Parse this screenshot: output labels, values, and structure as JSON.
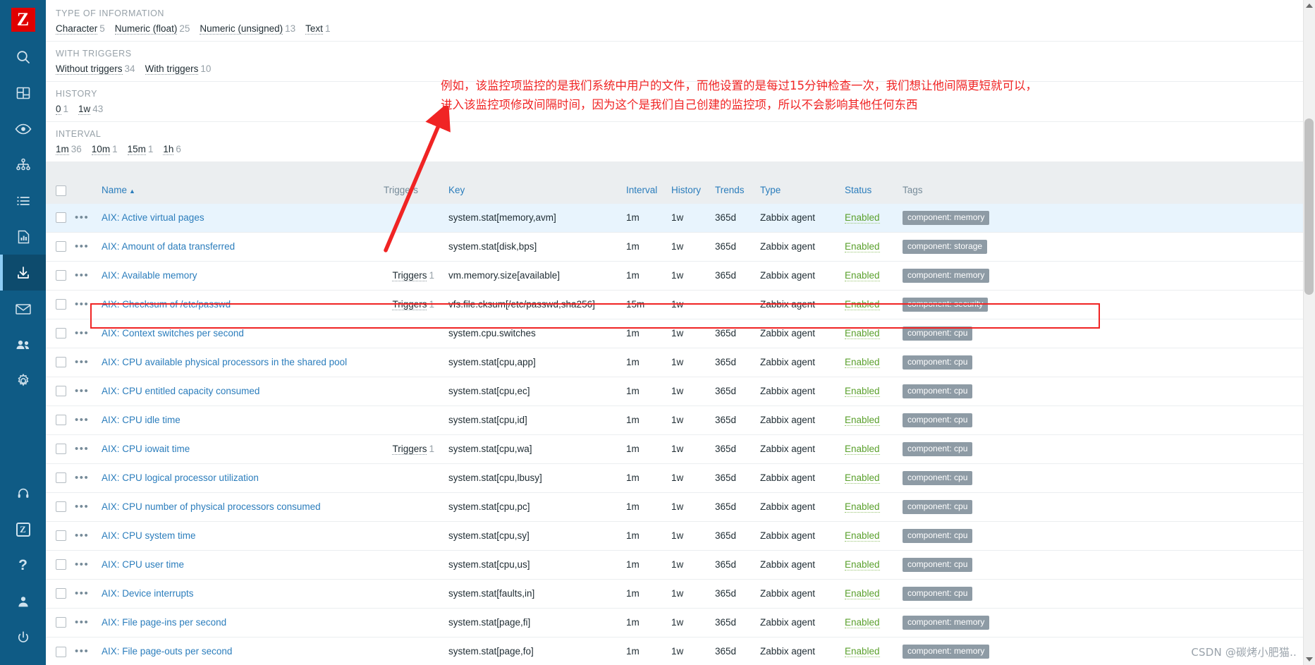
{
  "sidebar": {
    "logo_text": "Z",
    "items": [
      {
        "name": "search-icon",
        "label": "Search"
      },
      {
        "name": "dashboard-icon",
        "label": "Dashboards"
      },
      {
        "name": "eye-icon",
        "label": "Monitoring"
      },
      {
        "name": "network-map-icon",
        "label": "Services"
      },
      {
        "name": "list-icon",
        "label": "Inventory"
      },
      {
        "name": "report-icon",
        "label": "Reports"
      },
      {
        "name": "download-icon",
        "label": "Data collection",
        "active": true
      },
      {
        "name": "envelope-icon",
        "label": "Alerts"
      },
      {
        "name": "users-icon",
        "label": "Users"
      },
      {
        "name": "gear-icon",
        "label": "Administration"
      }
    ],
    "bottom_items": [
      {
        "name": "support-icon",
        "label": "Support"
      },
      {
        "name": "zabbix-integration-icon",
        "label": "Integrations"
      },
      {
        "name": "help-icon",
        "label": "Help"
      },
      {
        "name": "user-profile-icon",
        "label": "User settings"
      },
      {
        "name": "power-icon",
        "label": "Sign out"
      }
    ]
  },
  "filters": [
    {
      "title": "TYPE OF INFORMATION",
      "items": [
        {
          "label": "Character",
          "count": "5"
        },
        {
          "label": "Numeric (float)",
          "count": "25"
        },
        {
          "label": "Numeric (unsigned)",
          "count": "13"
        },
        {
          "label": "Text",
          "count": "1"
        }
      ]
    },
    {
      "title": "WITH TRIGGERS",
      "items": [
        {
          "label": "Without triggers",
          "count": "34"
        },
        {
          "label": "With triggers",
          "count": "10"
        }
      ]
    },
    {
      "title": "HISTORY",
      "items": [
        {
          "label": "0",
          "count": "1"
        },
        {
          "label": "1w",
          "count": "43"
        }
      ]
    },
    {
      "title": "INTERVAL",
      "items": [
        {
          "label": "1m",
          "count": "36"
        },
        {
          "label": "10m",
          "count": "1"
        },
        {
          "label": "15m",
          "count": "1"
        },
        {
          "label": "1h",
          "count": "6"
        }
      ]
    }
  ],
  "table": {
    "headers": {
      "name": "Name",
      "sort_arrow": "▲",
      "triggers": "Triggers",
      "key": "Key",
      "interval": "Interval",
      "history": "History",
      "trends": "Trends",
      "type": "Type",
      "status": "Status",
      "tags": "Tags"
    },
    "dots_glyph": "•••",
    "rows": [
      {
        "name": "AIX: Active virtual pages",
        "triggers": "",
        "triggers_count": "",
        "key": "system.stat[memory,avm]",
        "interval": "1m",
        "history": "1w",
        "trends": "365d",
        "type": "Zabbix agent",
        "status": "Enabled",
        "tag": "component: memory",
        "highlight": true
      },
      {
        "name": "AIX: Amount of data transferred",
        "triggers": "",
        "triggers_count": "",
        "key": "system.stat[disk,bps]",
        "interval": "1m",
        "history": "1w",
        "trends": "365d",
        "type": "Zabbix agent",
        "status": "Enabled",
        "tag": "component: storage"
      },
      {
        "name": "AIX: Available memory",
        "triggers": "Triggers",
        "triggers_count": "1",
        "key": "vm.memory.size[available]",
        "interval": "1m",
        "history": "1w",
        "trends": "365d",
        "type": "Zabbix agent",
        "status": "Enabled",
        "tag": "component: memory"
      },
      {
        "name": "AIX: Checksum of /etc/passwd",
        "triggers": "Triggers",
        "triggers_count": "1",
        "key": "vfs.file.cksum[/etc/passwd,sha256]",
        "interval": "15m",
        "history": "1w",
        "trends": "",
        "type": "Zabbix agent",
        "status": "Enabled",
        "tag": "component: security",
        "boxed": true
      },
      {
        "name": "AIX: Context switches per second",
        "triggers": "",
        "triggers_count": "",
        "key": "system.cpu.switches",
        "interval": "1m",
        "history": "1w",
        "trends": "365d",
        "type": "Zabbix agent",
        "status": "Enabled",
        "tag": "component: cpu"
      },
      {
        "name": "AIX: CPU available physical processors in the shared pool",
        "triggers": "",
        "triggers_count": "",
        "key": "system.stat[cpu,app]",
        "interval": "1m",
        "history": "1w",
        "trends": "365d",
        "type": "Zabbix agent",
        "status": "Enabled",
        "tag": "component: cpu"
      },
      {
        "name": "AIX: CPU entitled capacity consumed",
        "triggers": "",
        "triggers_count": "",
        "key": "system.stat[cpu,ec]",
        "interval": "1m",
        "history": "1w",
        "trends": "365d",
        "type": "Zabbix agent",
        "status": "Enabled",
        "tag": "component: cpu"
      },
      {
        "name": "AIX: CPU idle time",
        "triggers": "",
        "triggers_count": "",
        "key": "system.stat[cpu,id]",
        "interval": "1m",
        "history": "1w",
        "trends": "365d",
        "type": "Zabbix agent",
        "status": "Enabled",
        "tag": "component: cpu"
      },
      {
        "name": "AIX: CPU iowait time",
        "triggers": "Triggers",
        "triggers_count": "1",
        "key": "system.stat[cpu,wa]",
        "interval": "1m",
        "history": "1w",
        "trends": "365d",
        "type": "Zabbix agent",
        "status": "Enabled",
        "tag": "component: cpu"
      },
      {
        "name": "AIX: CPU logical processor utilization",
        "triggers": "",
        "triggers_count": "",
        "key": "system.stat[cpu,lbusy]",
        "interval": "1m",
        "history": "1w",
        "trends": "365d",
        "type": "Zabbix agent",
        "status": "Enabled",
        "tag": "component: cpu"
      },
      {
        "name": "AIX: CPU number of physical processors consumed",
        "triggers": "",
        "triggers_count": "",
        "key": "system.stat[cpu,pc]",
        "interval": "1m",
        "history": "1w",
        "trends": "365d",
        "type": "Zabbix agent",
        "status": "Enabled",
        "tag": "component: cpu"
      },
      {
        "name": "AIX: CPU system time",
        "triggers": "",
        "triggers_count": "",
        "key": "system.stat[cpu,sy]",
        "interval": "1m",
        "history": "1w",
        "trends": "365d",
        "type": "Zabbix agent",
        "status": "Enabled",
        "tag": "component: cpu"
      },
      {
        "name": "AIX: CPU user time",
        "triggers": "",
        "triggers_count": "",
        "key": "system.stat[cpu,us]",
        "interval": "1m",
        "history": "1w",
        "trends": "365d",
        "type": "Zabbix agent",
        "status": "Enabled",
        "tag": "component: cpu"
      },
      {
        "name": "AIX: Device interrupts",
        "triggers": "",
        "triggers_count": "",
        "key": "system.stat[faults,in]",
        "interval": "1m",
        "history": "1w",
        "trends": "365d",
        "type": "Zabbix agent",
        "status": "Enabled",
        "tag": "component: cpu"
      },
      {
        "name": "AIX: File page-ins per second",
        "triggers": "",
        "triggers_count": "",
        "key": "system.stat[page,fi]",
        "interval": "1m",
        "history": "1w",
        "trends": "365d",
        "type": "Zabbix agent",
        "status": "Enabled",
        "tag": "component: memory"
      },
      {
        "name": "AIX: File page-outs per second",
        "triggers": "",
        "triggers_count": "",
        "key": "system.stat[page,fo]",
        "interval": "1m",
        "history": "1w",
        "trends": "365d",
        "type": "Zabbix agent",
        "status": "Enabled",
        "tag": "component: memory"
      }
    ]
  },
  "annotation": {
    "line1": "例如，该监控项监控的是我们系统中用户的文件，而他设置的是每过15分钟检查一次，我们想让他间隔更短就可以，",
    "line2": "进入该监控项修改间隔时间，因为这个是我们自己创建的监控项，所以不会影响其他任何东西",
    "color": "#f02424"
  },
  "watermark": "CSDN @碳烤小肥猫..",
  "colors": {
    "sidebar_bg": "#0f5b85",
    "logo_bg": "#e00000",
    "link": "#2b7dbc",
    "enabled": "#5aa02c",
    "tag_bg": "#8e9ba5",
    "header_bg": "#ebeef0",
    "row_highlight": "#e8f4fd",
    "annotation_red": "#f02424"
  }
}
